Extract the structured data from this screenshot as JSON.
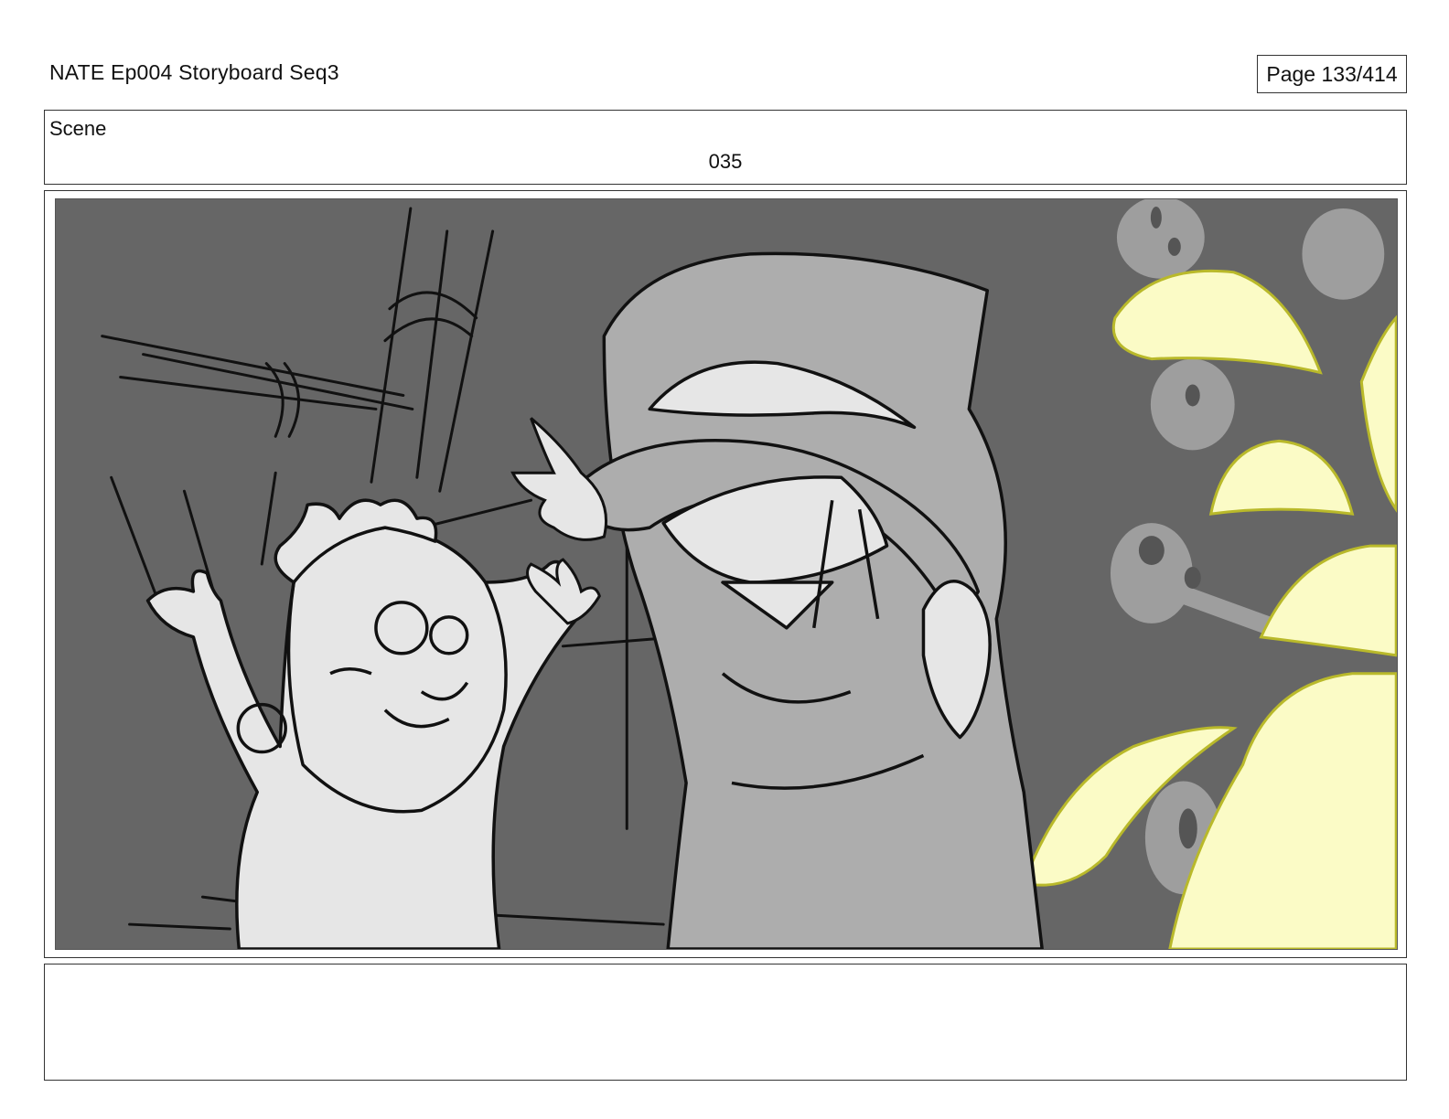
{
  "document": {
    "title": "NATE Ep004 Storyboard Seq3",
    "page_label": "Page 133/414"
  },
  "scene": {
    "label": "Scene",
    "number": "035"
  },
  "panel": {
    "colors": {
      "background": "#666666",
      "character_light": "#e6e6e6",
      "character_mid": "#adadad",
      "ghost_shapes": "#9e9e9e",
      "fx_yellow": "#fbfbc6",
      "fx_outline": "#b9b92a",
      "ink": "#111111"
    }
  },
  "notes": {
    "text": ""
  }
}
